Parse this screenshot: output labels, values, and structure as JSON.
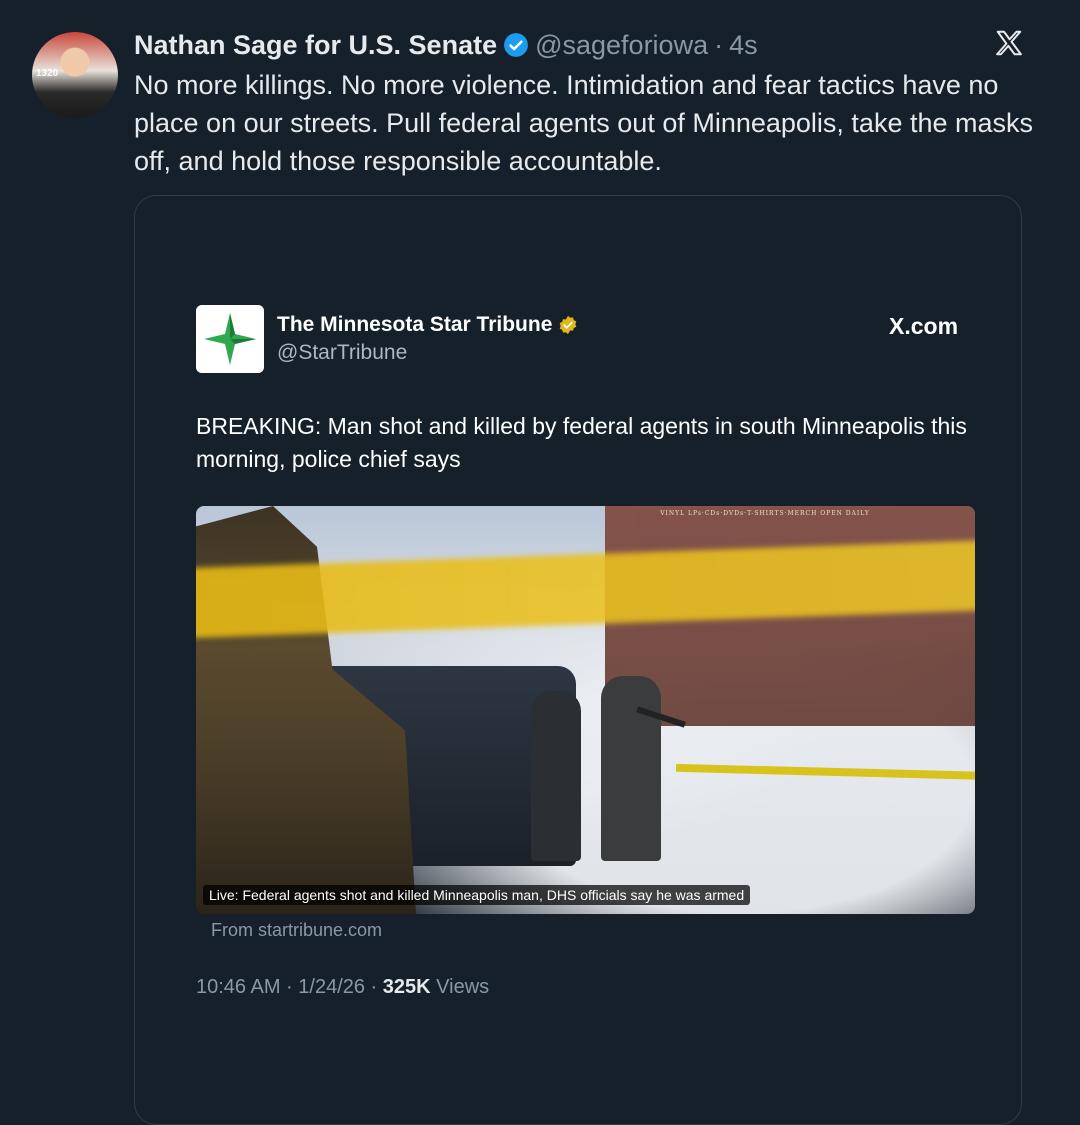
{
  "tweet": {
    "author_name": "Nathan Sage for U.S. Senate",
    "handle": "@sageforiowa",
    "separator": "·",
    "time": "4s",
    "text": "No more killings. No more violence. Intimidation and fear tactics have no place on our streets. Pull federal agents out of Minneapolis, take the masks off, and hold those responsible accountable.",
    "avatar_badge": "1320",
    "platform_icon": "x-logo-icon",
    "accent_color": "#1d9bf0"
  },
  "embed": {
    "account_name": "The Minnesota Star Tribune",
    "handle": "@StarTribune",
    "badge_color": "#e2b719",
    "source_label": "X.com",
    "text": "BREAKING: Man shot and killed by federal agents in south Minneapolis this morning, police chief says",
    "photo_caption": "Live: Federal agents shot and killed Minneapolis man, DHS officials say he was armed",
    "photo_sign": "VINYL LPs·CDs·DVDs·T-SHIRTS·MERCH OPEN DAILY",
    "link_source": "From startribune.com",
    "timestamp": "10:46 AM · 1/24/26 · ",
    "views_count": "325K",
    "views_label": " Views"
  }
}
